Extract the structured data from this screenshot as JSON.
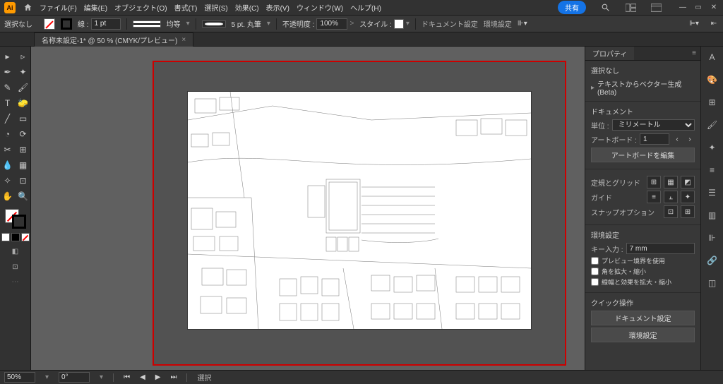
{
  "menubar": {
    "app_abbrev": "Ai",
    "items": [
      "ファイル(F)",
      "編集(E)",
      "オブジェクト(O)",
      "書式(T)",
      "選択(S)",
      "効果(C)",
      "表示(V)",
      "ウィンドウ(W)",
      "ヘルプ(H)"
    ],
    "share": "共有"
  },
  "optbar": {
    "selection": "選択なし",
    "stroke_label": "線 :",
    "stroke_width": "1 pt",
    "uniform": "均等",
    "brush": "5 pt. 丸筆",
    "opacity_label": "不透明度 :",
    "opacity": "100%",
    "style_label": "スタイル :",
    "doc_setup": "ドキュメント設定",
    "prefs": "環境設定"
  },
  "tab": {
    "title": "名称未設定-1* @ 50 % (CMYK/プレビュー)"
  },
  "props": {
    "panel_title": "プロパティ",
    "nosel": "選択なし",
    "vector_gen": "テキストからベクター生成 (Beta)",
    "doc_header": "ドキュメント",
    "unit_label": "単位 :",
    "unit_value": "ミリメートル",
    "artboard_label": "アートボード :",
    "artboard_value": "1",
    "edit_artboard": "アートボードを編集",
    "rulers_header": "定規とグリッド",
    "guides_header": "ガイド",
    "snap_header": "スナップオプション",
    "prefs_header": "環境設定",
    "key_label": "キー入力 :",
    "key_value": "7 mm",
    "chk_preview": "プレビュー境界を使用",
    "chk_corners": "角を拡大・縮小",
    "chk_strokes": "線幅と効果を拡大・縮小",
    "quick_header": "クイック操作",
    "btn_docsetup": "ドキュメント設定",
    "btn_prefs": "環境設定"
  },
  "status": {
    "zoom": "50%",
    "rotation": "0°",
    "label": "選択"
  },
  "tools": {
    "left_col": [
      "▸",
      "▾",
      "✒",
      "✎",
      "T",
      "/",
      "◻",
      "◔",
      "✂",
      "◫",
      "◐",
      "✦",
      "|"
    ],
    "right_col": [
      "▹",
      "✦",
      "🖌",
      "🧽",
      "▭",
      "╱",
      "⟳",
      "⊞",
      "🔍",
      "🔎",
      "✋",
      "✧",
      "Q"
    ]
  }
}
